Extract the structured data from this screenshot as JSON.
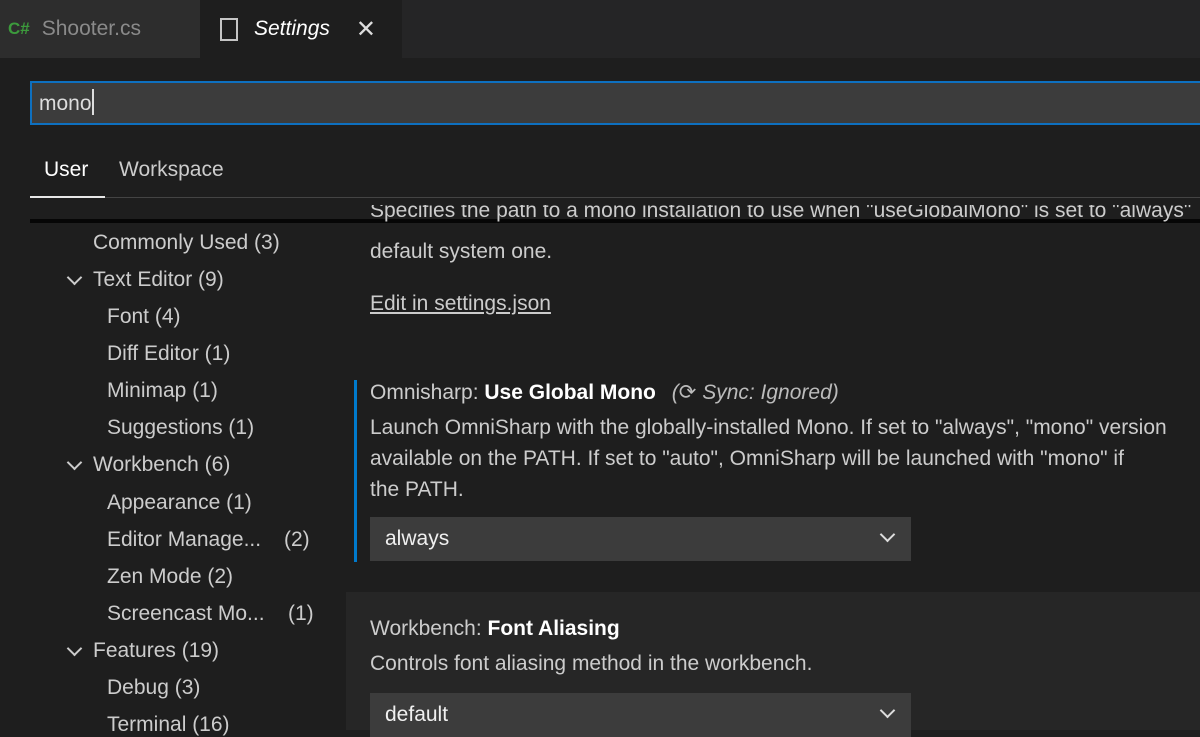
{
  "tabs": [
    {
      "label": "Shooter.cs",
      "icon": "csharp-icon",
      "badge": "C#"
    },
    {
      "label": "Settings",
      "icon": "file-icon"
    }
  ],
  "search": {
    "value": "mono"
  },
  "scopes": {
    "user": "User",
    "workspace": "Workspace"
  },
  "toc": [
    {
      "label": "Commonly Used (3)"
    },
    {
      "label": "Text Editor (9)",
      "expanded": true
    },
    {
      "label": "Font (4)"
    },
    {
      "label": "Diff Editor (1)"
    },
    {
      "label": "Minimap (1)"
    },
    {
      "label": "Suggestions (1)"
    },
    {
      "label": "Workbench (6)",
      "expanded": true
    },
    {
      "label": "Appearance (1)"
    },
    {
      "label": "Editor Manage...",
      "count": "(2)"
    },
    {
      "label": "Zen Mode (2)"
    },
    {
      "label": "Screencast Mo...",
      "count": "(1)"
    },
    {
      "label": "Features (19)",
      "expanded": true
    },
    {
      "label": "Debug (3)"
    },
    {
      "label": "Terminal (16)"
    }
  ],
  "settings": {
    "prev": {
      "desc1": "Specifies the path to a mono installation to use when \"useGlobalMono\" is set to \"always\"",
      "desc2": "default system one.",
      "edit_link": "Edit in settings.json"
    },
    "global_mono": {
      "category": "Omnisharp: ",
      "name": "Use Global Mono",
      "sync": "Sync: Ignored)",
      "sync_open": "(",
      "desc1": "Launch OmniSharp with the globally-installed Mono. If set to \"always\", \"mono\" version",
      "desc2": "available on the PATH. If set to \"auto\", OmniSharp will be launched with \"mono\" if",
      "desc3": "the PATH.",
      "value": "always"
    },
    "font_aliasing": {
      "category": "Workbench: ",
      "name": "Font Aliasing",
      "desc": "Controls font aliasing method in the workbench.",
      "value": "default"
    }
  },
  "colors": {
    "accent": "#007acc",
    "focus": "#0e70c0",
    "csharp": "#3c9a3c"
  }
}
